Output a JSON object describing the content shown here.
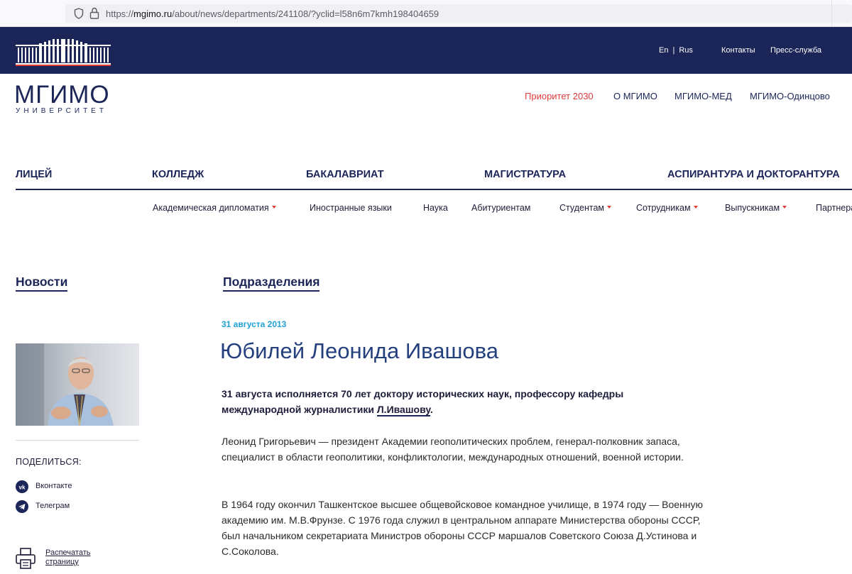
{
  "browser": {
    "url_prefix": "https://",
    "url_host": "mgimo.ru",
    "url_path": "/about/news/departments/241108/?yclid=l58n6m7kmh198404659"
  },
  "topbar": {
    "lang_en": "En",
    "lang_sep": "|",
    "lang_ru": "Rus",
    "contacts": "Контакты",
    "press": "Пресс-служба"
  },
  "logo": {
    "title": "МГИМО",
    "subtitle": "УНИВЕРСИТЕТ"
  },
  "main_nav": {
    "priority": "Приоритет 2030",
    "about": "О МГИМО",
    "med": "МГИМО-МЕД",
    "odintsovo": "МГИМО-Одинцово"
  },
  "levels": [
    "ЛИЦЕЙ",
    "КОЛЛЕДЖ",
    "БАКАЛАВРИАТ",
    "МАГИСТРАТУРА",
    "АСПИРАНТУРА И ДОКТОРАНТУРА"
  ],
  "submenu": [
    {
      "label": "Академическая дипломатия",
      "dropdown": true
    },
    {
      "label": "Иностранные языки",
      "dropdown": false
    },
    {
      "label": "Наука",
      "dropdown": false
    },
    {
      "label": "Абитуриентам",
      "dropdown": false
    },
    {
      "label": "Студентам",
      "dropdown": true
    },
    {
      "label": "Сотрудникам",
      "dropdown": true
    },
    {
      "label": "Выпускникам",
      "dropdown": true
    },
    {
      "label": "Партнерам",
      "dropdown": false
    }
  ],
  "sidebar": {
    "news": "Новости",
    "share_label": "ПОДЕЛИТЬСЯ:",
    "vk": "Вконтакте",
    "telegram": "Телеграм",
    "print": "Распечатать страницу"
  },
  "article": {
    "section": "Подразделения",
    "date": "31 августа 2013",
    "title": "Юбилей Леонида Ивашова",
    "lead_text": "31 августа исполняется 70 лет доктору исторических наук, профессору кафедры международной журналистики ",
    "lead_name": "Л.Ивашову",
    "lead_end": ".",
    "p1": "Леонид Григорьевич — президент Академии геополитических проблем, генерал-полковник запаса, специалист в области геополитики, конфликтологии, международных отношений, военной истории.",
    "p2": "В 1964 году окончил Ташкентское высшее общевойсковое командное училище, в 1974 году — Военную академию им. М.В.Фрунзе. С 1976 года служил в центральном аппарате Министерства обороны СССР, был начальником секретариата Министров обороны СССР маршалов Советского Союза Д.Устинова и С.Соколова."
  },
  "colors": {
    "brand_navy": "#1b2557",
    "accent_red": "#e23b3b",
    "date_blue": "#1fa1d6",
    "title_blue": "#233f7e"
  },
  "icons": [
    "shield-icon",
    "lock-icon",
    "university-building-logo",
    "vk-icon",
    "telegram-icon",
    "printer-icon"
  ]
}
